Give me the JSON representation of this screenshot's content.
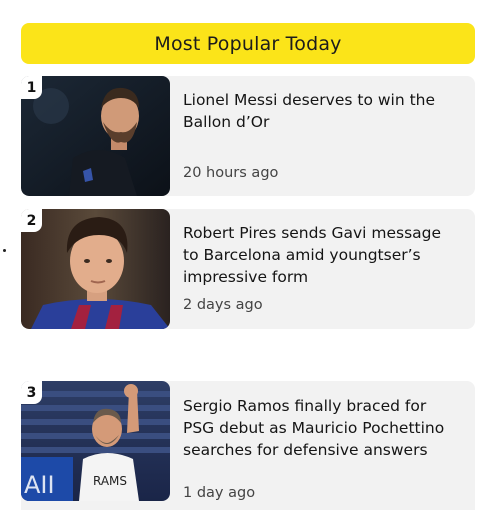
{
  "header": {
    "title": "Most Popular Today",
    "background": "#fbe419"
  },
  "articles": [
    {
      "rank": "1",
      "title": "Lionel Messi deserves to win the Ballon d’Or",
      "time": "20 hours ago",
      "thumbnail_icon": "messi-photo"
    },
    {
      "rank": "2",
      "title": "Robert Pires sends Gavi message to Barcelona amid youngtser’s impressive form",
      "time": "2 days ago",
      "thumbnail_icon": "gavi-photo"
    },
    {
      "rank": "3",
      "title": "Sergio Ramos finally braced for PSG debut as Mauricio Pochettino searches for defensive answers",
      "time": "1 day ago",
      "thumbnail_icon": "ramos-photo"
    }
  ],
  "colors": {
    "card_background": "#f2f2f2",
    "text": "#151515",
    "meta_text": "#444444"
  }
}
